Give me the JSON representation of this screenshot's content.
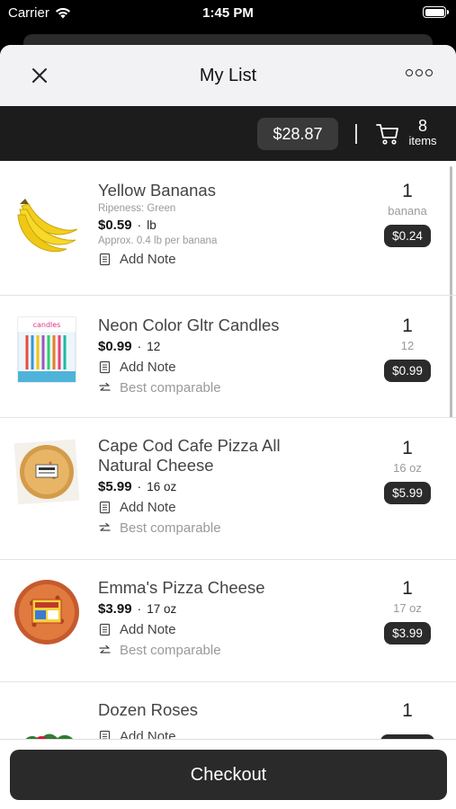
{
  "status_bar": {
    "carrier": "Carrier",
    "time": "1:45 PM"
  },
  "nav": {
    "title": "My List"
  },
  "summary": {
    "total": "$28.87",
    "item_count": "8",
    "items_label": "items"
  },
  "items": [
    {
      "name": "Yellow Bananas",
      "ripeness": "Ripeness: Green",
      "price": "$0.59",
      "unit": "lb",
      "approx": "Approx. 0.4 lb per banana",
      "add_note": "Add Note",
      "quantity": "1",
      "qty_unit": "banana",
      "line_total": "$0.24"
    },
    {
      "name": "Neon Color Gltr Candles",
      "price": "$0.99",
      "unit": "12",
      "add_note": "Add Note",
      "comparable": "Best comparable",
      "quantity": "1",
      "qty_unit": "12",
      "line_total": "$0.99"
    },
    {
      "name": "Cape Cod Cafe Pizza All Natural Cheese",
      "price": "$5.99",
      "unit": "16 oz",
      "add_note": "Add Note",
      "comparable": "Best comparable",
      "quantity": "1",
      "qty_unit": "16 oz",
      "line_total": "$5.99"
    },
    {
      "name": "Emma's Pizza Cheese",
      "price": "$3.99",
      "unit": "17 oz",
      "add_note": "Add Note",
      "comparable": "Best comparable",
      "quantity": "1",
      "qty_unit": "17 oz",
      "line_total": "$3.99"
    },
    {
      "name": "Dozen Roses",
      "add_note": "Add Note",
      "quantity": "1"
    }
  ],
  "checkout": {
    "label": "Checkout"
  },
  "icons": {
    "close": "close-icon",
    "more": "more-icon",
    "cart": "cart-icon",
    "note": "note-icon",
    "swap": "swap-icon"
  },
  "colors": {
    "dark_bar": "#1c1c1c",
    "pill": "#2b2b2b",
    "nav_bg": "#f2f2f4"
  }
}
